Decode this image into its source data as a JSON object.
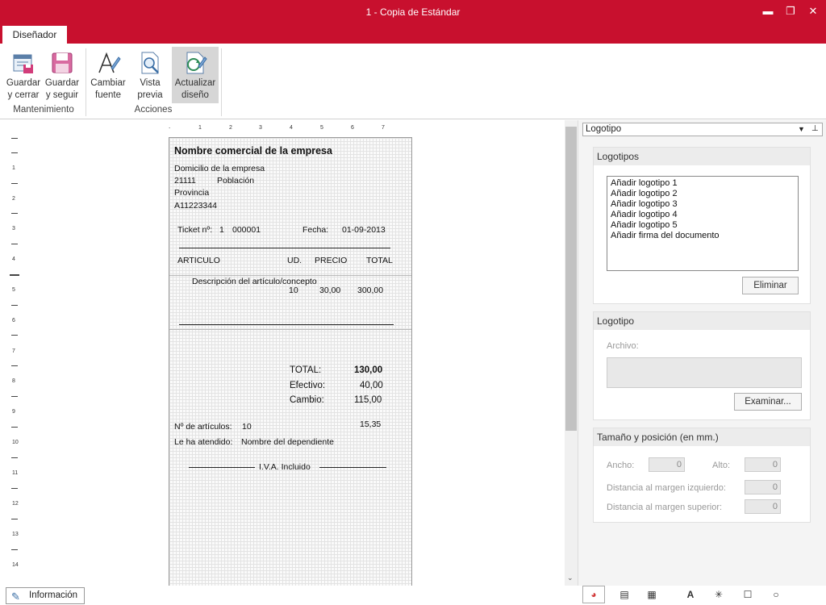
{
  "window": {
    "title": "1 - Copia de Estándar",
    "minimize": "▬",
    "maximize": "❐",
    "close": "✕"
  },
  "ribbon": {
    "tab": "Diseñador",
    "buttons": [
      {
        "l1": "Guardar",
        "l2": "y cerrar"
      },
      {
        "l1": "Guardar",
        "l2": "y seguir"
      },
      {
        "l1": "Cambiar",
        "l2": "fuente"
      },
      {
        "l1": "Vista",
        "l2": "previa"
      },
      {
        "l1": "Actualizar",
        "l2": "diseño"
      }
    ],
    "groups": [
      "Mantenimiento",
      "Acciones"
    ]
  },
  "ruler": {
    "h": [
      "1",
      "2",
      "3",
      "4",
      "5",
      "6",
      "7"
    ],
    "v": [
      "1",
      "2",
      "3",
      "4",
      "5",
      "6",
      "7",
      "8",
      "9",
      "10",
      "11",
      "12",
      "13",
      "14"
    ]
  },
  "ticket": {
    "company": "Nombre  comercial de la empresa",
    "address": "Domicilio de la empresa",
    "postal": "21111",
    "town": "Población",
    "province": "Provincia",
    "nif": "A11223344",
    "ticket_label": "Ticket nº:",
    "ticket_series": "1",
    "ticket_number": "000001",
    "date_label": "Fecha:",
    "date": "01-09-2013",
    "col_article": "ARTICULO",
    "col_units": "UD.",
    "col_price": "PRECIO",
    "col_total": "TOTAL",
    "item_desc": "Descripción del artículo/concepto",
    "item_units": "10",
    "item_price": "30,00",
    "item_total": "300,00",
    "total_label": "TOTAL:",
    "total_value": "130,00",
    "cash_label": "Efectivo:",
    "cash_value": "40,00",
    "change_label": "Cambio:",
    "change_value": "115,00",
    "articles_label": "Nº de artículos:",
    "articles_value": "10",
    "misc_value": "15,35",
    "served_label": "Le ha atendido:",
    "served_value": "Nombre del dependiente",
    "vat_note": "I.V.A. Incluido"
  },
  "panel": {
    "selector": "Logotipo",
    "logos_header": "Logotipos",
    "logos": [
      "Añadir logotipo 1",
      "Añadir logotipo 2",
      "Añadir logotipo 3",
      "Añadir logotipo 4",
      "Añadir logotipo 5",
      "Añadir firma del documento"
    ],
    "delete_button": "Eliminar",
    "logo_header": "Logotipo",
    "file_label": "Archivo:",
    "browse_button": "Examinar...",
    "size_header": "Tamaño y posición (en mm.)",
    "width_label": "Ancho:",
    "width_value": "0",
    "height_label": "Alto:",
    "height_value": "0",
    "left_label": "Distancia al margen izquierdo:",
    "left_value": "0",
    "top_label": "Distancia al margen superior:",
    "top_value": "0"
  },
  "bottom": {
    "info": "Información"
  }
}
